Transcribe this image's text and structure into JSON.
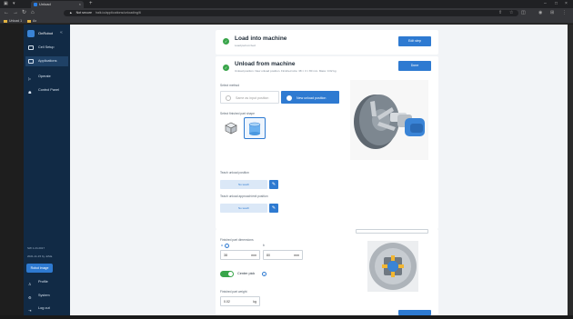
{
  "browser": {
    "tab_title": "Unload",
    "url_security": "Not secure",
    "url": "halk.io/applications/unloading/6",
    "bookmarks": [
      "Unload 1",
      "Ax"
    ]
  },
  "sidebar": {
    "title": "OnRobot",
    "items": [
      {
        "label": "Cell Setup"
      },
      {
        "label": "Applications"
      },
      {
        "label": "Operate"
      },
      {
        "label": "Control Panel"
      }
    ],
    "meta_line1": "SW 1.24.2017",
    "meta_line2": "2021-11-15 by JoMa",
    "button_label": "Robot image",
    "bottom_items": [
      {
        "label": "Profile"
      },
      {
        "label": "System"
      },
      {
        "label": "Log out"
      }
    ]
  },
  "load_card": {
    "title": "Load into machine",
    "subtitle": "Load part on bed",
    "button": "Edit step"
  },
  "unload_card": {
    "title": "Unload from machine",
    "subtitle": "Unload position. New unload position. Finished size: 38 × 3 × 80 mm. Mass: 0.02 kg",
    "button": "Done",
    "select_method_label": "Select method",
    "option_existing": "Same as input position",
    "option_new": "New unload position",
    "finished_shape_label": "Select finished part shape",
    "teach_unload_label": "Teach unload position",
    "teach_unload_btn": "No teach",
    "teach_approach_label": "Teach unload approach/exit position",
    "teach_approach_btn": "No teach"
  },
  "dimensions_card": {
    "section_label": "Finished part dimensions",
    "dim_a_label": "a",
    "dim_b_label": "b",
    "dim_a_value": "38",
    "dim_b_value": "80",
    "unit": "mm",
    "center_pick_label": "Center pick",
    "weight_label": "Finished part weight",
    "weight_value": "0.02",
    "weight_unit": "kg"
  },
  "colors": {
    "accent": "#2e7ad1",
    "sidebar": "#112a45",
    "success": "#39a54a"
  }
}
